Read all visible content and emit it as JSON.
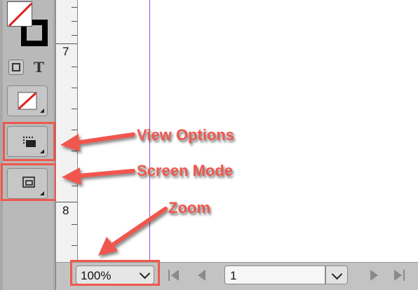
{
  "toolbar": {
    "type_tool_glyph": "T",
    "icons": {
      "fill": "fill-none-swatch-icon",
      "stroke": "stroke-swatch-icon",
      "container": "formatting-container-icon",
      "text": "formatting-text-icon",
      "apply_none": "apply-none-icon",
      "view_options": "view-options-icon",
      "screen_mode": "screen-mode-icon"
    }
  },
  "ruler": {
    "labels": [
      "7",
      "8"
    ]
  },
  "status_bar": {
    "zoom_value": "100%",
    "page_value": "1",
    "icons": {
      "first": "first-page-icon",
      "prev": "previous-page-icon",
      "next": "next-page-icon",
      "last": "last-page-icon",
      "zoom_dropdown": "chevron-down-icon",
      "page_dropdown": "chevron-down-icon"
    }
  },
  "annotations": {
    "view_options": "View Options",
    "screen_mode": "Screen Mode",
    "zoom": "Zoom"
  },
  "colors": {
    "annotation": "#f0574d",
    "guide": "#9b4fc0",
    "toolbar_bg": "#b9b9b9",
    "status_bg": "#c3c3c3"
  }
}
